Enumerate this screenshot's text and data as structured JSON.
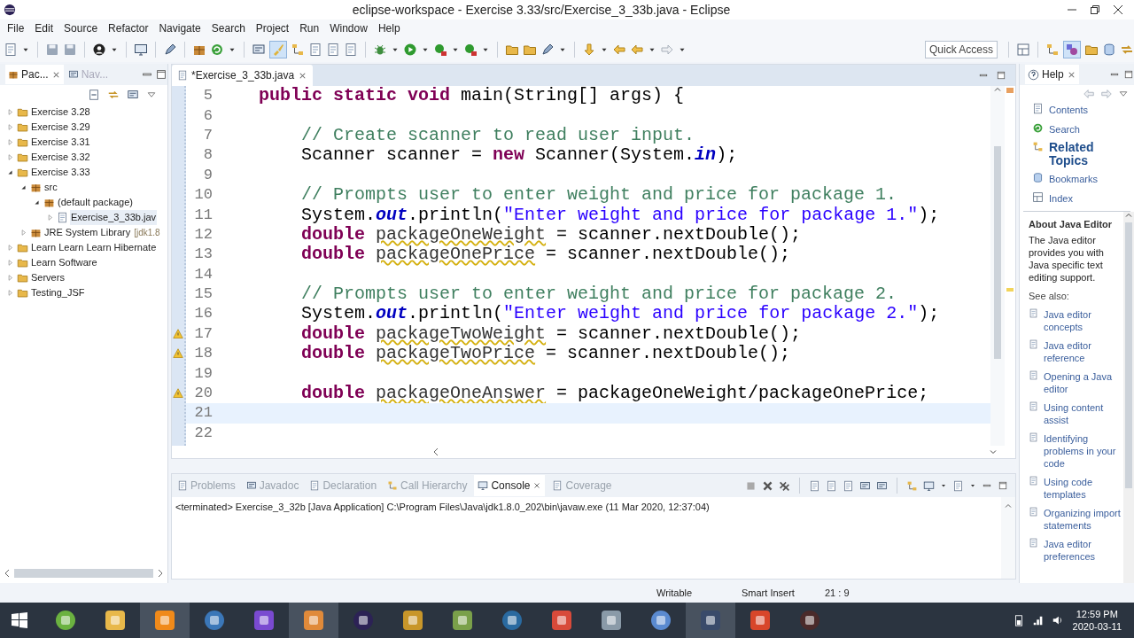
{
  "window": {
    "title": "eclipse-workspace - Exercise 3.33/src/Exercise_3_33b.java - Eclipse"
  },
  "menu": [
    "File",
    "Edit",
    "Source",
    "Refactor",
    "Navigate",
    "Search",
    "Project",
    "Run",
    "Window",
    "Help"
  ],
  "quick_access": {
    "placeholder": "Quick Access"
  },
  "left_tabs": [
    {
      "label": "Pac...",
      "selected": true
    },
    {
      "label": "Nav...",
      "selected": false
    }
  ],
  "tree": [
    {
      "label": "Exercise 3.28",
      "expanded": false
    },
    {
      "label": "Exercise 3.29",
      "expanded": false
    },
    {
      "label": "Exercise 3.31",
      "expanded": false
    },
    {
      "label": "Exercise 3.32",
      "expanded": false
    },
    {
      "label": "Exercise 3.33",
      "expanded": true,
      "children": [
        {
          "label": "src",
          "expanded": true,
          "children": [
            {
              "label": "(default package)",
              "expanded": true,
              "children": [
                {
                  "label": "Exercise_3_33b.jav",
                  "expanded": false,
                  "selected": true
                }
              ]
            }
          ]
        },
        {
          "label": "JRE System Library",
          "suffix": "[jdk1.8",
          "expanded": false
        }
      ]
    },
    {
      "label": "Learn Learn Learn Hibernate",
      "expanded": false
    },
    {
      "label": "Learn Software",
      "expanded": false
    },
    {
      "label": "Servers",
      "expanded": false
    },
    {
      "label": "Testing_JSF",
      "expanded": false
    }
  ],
  "editor": {
    "tab": "*Exercise_3_33b.java",
    "lines": [
      {
        "number": "5",
        "current": false,
        "warning": false,
        "tokens": [
          {
            "kind": "keyword",
            "text": "    public static void"
          },
          {
            "kind": "plain",
            "text": " main(String[] args) {"
          }
        ]
      },
      {
        "number": "6",
        "current": false,
        "warning": false
      },
      {
        "number": "7",
        "current": false,
        "warning": false,
        "tokens": [
          {
            "kind": "comment",
            "text": "        // Create scanner to read user input."
          }
        ]
      },
      {
        "number": "8",
        "current": false,
        "warning": false,
        "tokens": [
          {
            "kind": "plain",
            "text": "        Scanner scanner = "
          },
          {
            "kind": "keyword",
            "text": "new"
          },
          {
            "kind": "plain",
            "text": " Scanner(System."
          },
          {
            "kind": "field",
            "text": "in"
          },
          {
            "kind": "plain",
            "text": ");"
          }
        ]
      },
      {
        "number": "9",
        "current": false,
        "warning": false
      },
      {
        "number": "10",
        "current": false,
        "warning": false,
        "tokens": [
          {
            "kind": "comment",
            "text": "        // Prompts user to enter weight and price for package 1."
          }
        ]
      },
      {
        "number": "11",
        "current": false,
        "warning": false,
        "tokens": [
          {
            "kind": "plain",
            "text": "        System."
          },
          {
            "kind": "field",
            "text": "out"
          },
          {
            "kind": "plain",
            "text": ".println("
          },
          {
            "kind": "string",
            "text": "\"Enter weight and price for package 1.\""
          },
          {
            "kind": "plain",
            "text": ");"
          }
        ]
      },
      {
        "number": "12",
        "current": false,
        "warning": false,
        "tokens": [
          {
            "kind": "keyword",
            "text": "        double "
          },
          {
            "kind": "variable",
            "text": "packageOneWeight"
          },
          {
            "kind": "plain",
            "text": " = scanner.nextDouble();"
          }
        ]
      },
      {
        "number": "13",
        "current": false,
        "warning": false,
        "tokens": [
          {
            "kind": "keyword",
            "text": "        double "
          },
          {
            "kind": "variable",
            "text": "packageOnePrice"
          },
          {
            "kind": "plain",
            "text": " = scanner.nextDouble();"
          }
        ]
      },
      {
        "number": "14",
        "current": false,
        "warning": false
      },
      {
        "number": "15",
        "current": false,
        "warning": false,
        "tokens": [
          {
            "kind": "comment",
            "text": "        // Prompts user to enter weight and price for package 2."
          }
        ]
      },
      {
        "number": "16",
        "current": false,
        "warning": false,
        "tokens": [
          {
            "kind": "plain",
            "text": "        System."
          },
          {
            "kind": "field",
            "text": "out"
          },
          {
            "kind": "plain",
            "text": ".println("
          },
          {
            "kind": "string",
            "text": "\"Enter weight and price for package 2.\""
          },
          {
            "kind": "plain",
            "text": ");"
          }
        ]
      },
      {
        "number": "17",
        "current": false,
        "warning": true,
        "tokens": [
          {
            "kind": "keyword",
            "text": "        double "
          },
          {
            "kind": "variable",
            "text": "packageTwoWeight"
          },
          {
            "kind": "plain",
            "text": " = scanner.nextDouble();"
          }
        ]
      },
      {
        "number": "18",
        "current": false,
        "warning": true,
        "tokens": [
          {
            "kind": "keyword",
            "text": "        double "
          },
          {
            "kind": "variable",
            "text": "packageTwoPrice"
          },
          {
            "kind": "plain",
            "text": " = scanner.nextDouble();"
          }
        ]
      },
      {
        "number": "19",
        "current": false,
        "warning": false
      },
      {
        "number": "20",
        "current": false,
        "warning": true,
        "tokens": [
          {
            "kind": "keyword",
            "text": "        double "
          },
          {
            "kind": "variable",
            "text": "packageOneAnswer"
          },
          {
            "kind": "plain",
            "text": " = packageOneWeight/packageOnePrice;"
          }
        ]
      },
      {
        "number": "21",
        "current": true,
        "warning": false
      },
      {
        "number": "22",
        "current": false,
        "warning": false
      }
    ]
  },
  "bottom_tabs": [
    {
      "label": "Problems",
      "selected": false
    },
    {
      "label": "Javadoc",
      "selected": false
    },
    {
      "label": "Declaration",
      "selected": false
    },
    {
      "label": "Call Hierarchy",
      "selected": false
    },
    {
      "label": "Console",
      "selected": true
    },
    {
      "label": "Coverage",
      "selected": false
    }
  ],
  "console": "<terminated> Exercise_3_32b [Java Application] C:\\Program Files\\Java\\jdk1.8.0_202\\bin\\javaw.exe (11 Mar 2020, 12:37:04)",
  "help": {
    "tab": "Help",
    "links": [
      {
        "label": "Contents",
        "selected": false
      },
      {
        "label": "Search",
        "selected": false
      },
      {
        "label": "Related Topics",
        "selected": true
      },
      {
        "label": "Bookmarks",
        "selected": false
      },
      {
        "label": "Index",
        "selected": false
      }
    ],
    "about_title": "About Java Editor",
    "about_text": "The Java editor provides you with Java specific text editing support.",
    "see_also": "See also:",
    "topics": [
      "Java editor concepts",
      "Java editor reference",
      "Opening a Java editor",
      "Using content assist",
      "Identifying problems in your code",
      "Using code templates",
      "Organizing import statements",
      "Java editor preferences"
    ]
  },
  "status_bar": {
    "mode": "Writable",
    "insert": "Smart Insert",
    "position": "21 : 9"
  },
  "clock": {
    "time": "12:59 PM",
    "date": "2020-03-11"
  }
}
